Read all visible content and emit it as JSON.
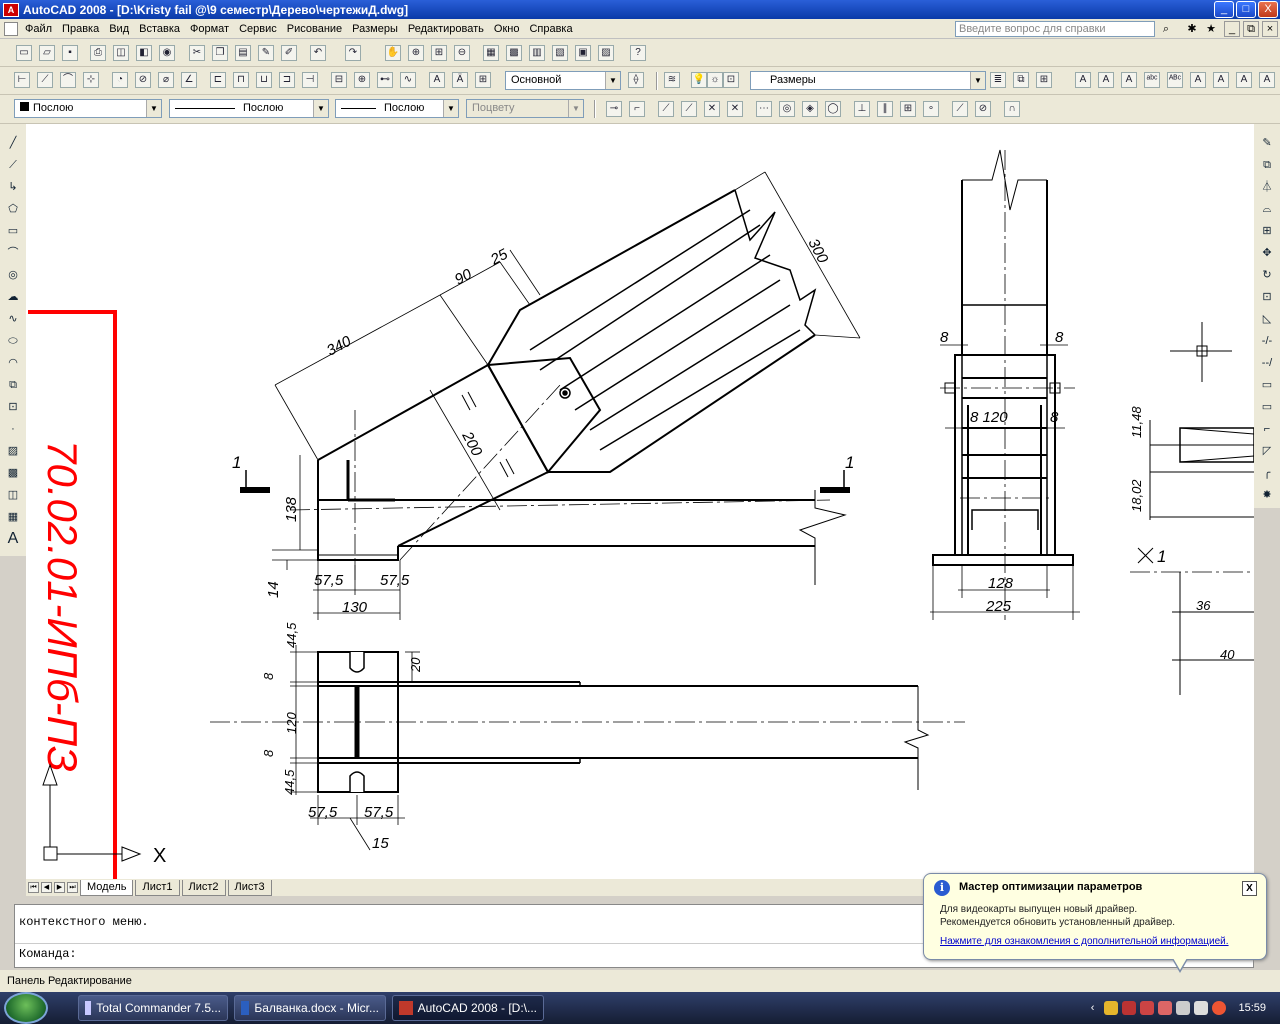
{
  "window": {
    "title": "AutoCAD 2008 - [D:\\Kristy fail @\\9 семестр\\Дерево\\чертежиД.dwg]",
    "app_icon_text": "A",
    "btn_min": "_",
    "btn_max": "□",
    "btn_close": "X"
  },
  "menu": {
    "items": [
      "Файл",
      "Правка",
      "Вид",
      "Вставка",
      "Формат",
      "Сервис",
      "Рисование",
      "Размеры",
      "Редактировать",
      "Окно",
      "Справка"
    ],
    "help_placeholder": "Введите вопрос для справки"
  },
  "toolbars": {
    "text_style": "Основной",
    "dim_style": "Размеры",
    "color": "Послою",
    "linetype": "Послою",
    "lineweight": "Послою",
    "plotstyle": "Поцвету"
  },
  "drawing": {
    "stamp_text": "70.02.01-ИПб-ПЗ",
    "dims": {
      "d340": "340",
      "d90": "90",
      "d25": "25",
      "d300": "300",
      "d200": "200",
      "d138": "138",
      "d14": "14",
      "d57_5a": "57,5",
      "d57_5b": "57,5",
      "d130": "130",
      "s1_left": "1",
      "s1_right": "1",
      "d44_5a": "44,5",
      "d8a": "8",
      "d20": "20",
      "d120_v": "120",
      "d8b": "8",
      "d44_5b": "44,5",
      "d57_5c": "57,5",
      "d57_5d": "57,5",
      "d15": "15",
      "d8_l": "8",
      "d8_r": "8",
      "d8_120": "8 120",
      "d8_r2": "8",
      "d128": "128",
      "d225": "225",
      "d11_48": "11,48",
      "d18_02": "18,02",
      "x1": "1",
      "d36": "36",
      "d40": "40"
    }
  },
  "tabs": {
    "items": [
      "Модель",
      "Лист1",
      "Лист2",
      "Лист3"
    ],
    "active": "Модель"
  },
  "command": {
    "history": "контекстного меню.",
    "prompt": "Команда:"
  },
  "status_text": "Панель Редактирование",
  "popup": {
    "title": "Мастер оптимизации параметров",
    "line1": "Для видеокарты выпущен новый драйвер.",
    "line2": "Рекомендуется обновить установленный драйвер.",
    "link": "Нажмите для ознакомления с дополнительной информацией.",
    "close": "X"
  },
  "taskbar": {
    "items": [
      {
        "label": "Total Commander 7.5...",
        "color": "#c8c8ff"
      },
      {
        "label": "Балванка.docx - Micr...",
        "color": "#2b5fbf"
      },
      {
        "label": "AutoCAD 2008 - [D:\\...",
        "color": "#c0392b"
      }
    ],
    "clock": "15:59"
  },
  "axis": {
    "x_label": "X"
  }
}
